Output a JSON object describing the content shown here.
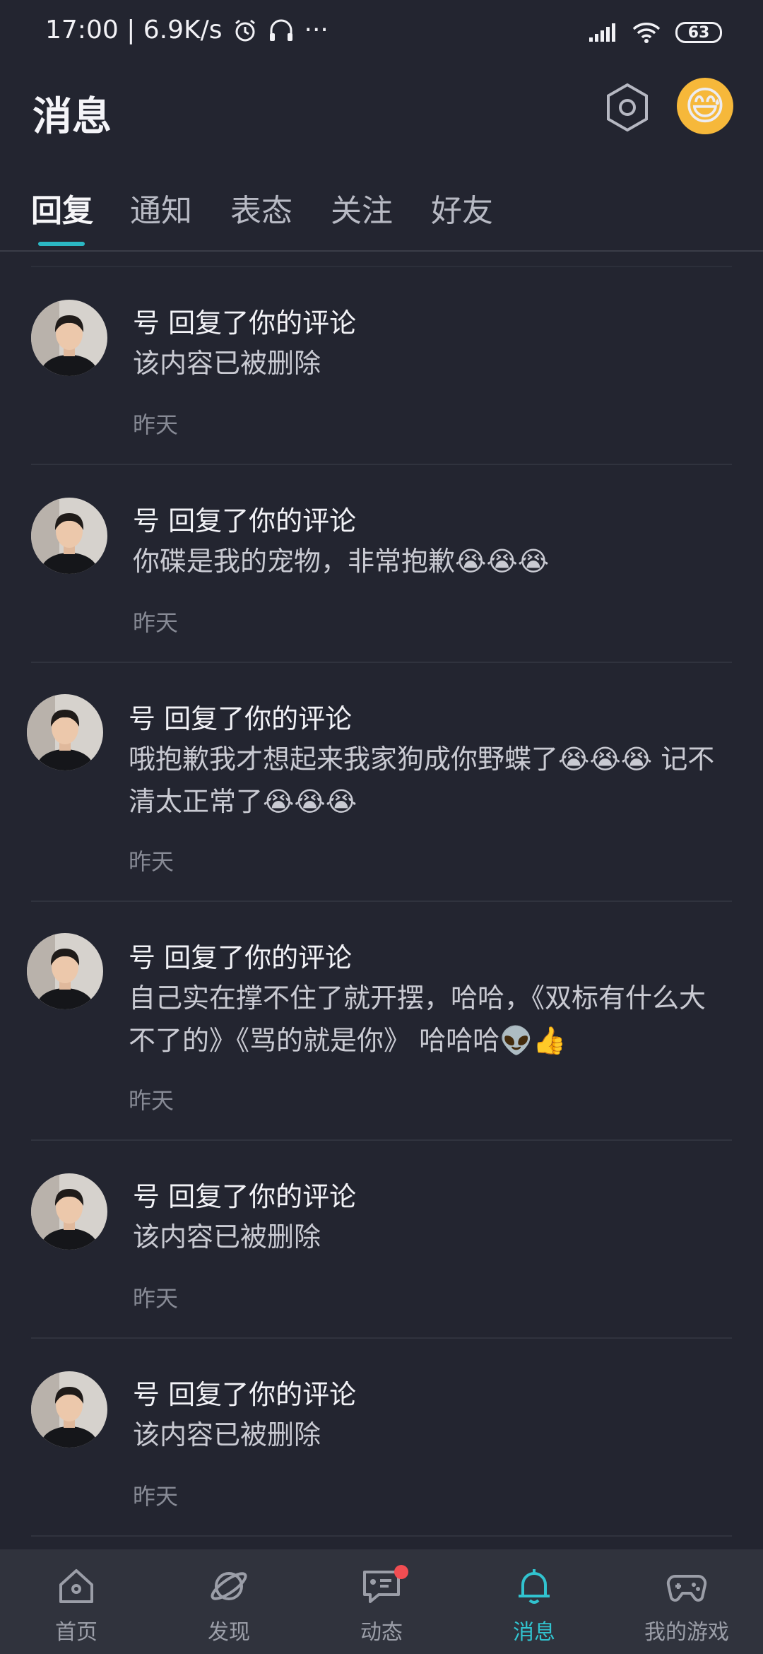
{
  "status": {
    "time_speed": "17:00 | 6.9K/s",
    "more": "···",
    "battery": "63"
  },
  "header": {
    "title": "消息"
  },
  "tabs": [
    {
      "label": "回复",
      "active": true
    },
    {
      "label": "通知",
      "active": false
    },
    {
      "label": "表态",
      "active": false
    },
    {
      "label": "关注",
      "active": false
    },
    {
      "label": "好友",
      "active": false
    }
  ],
  "items": [
    {
      "title": "号 回复了你的评论",
      "body": "该内容已被删除",
      "time": "昨天"
    },
    {
      "title": "号 回复了你的评论",
      "body": "你碟是我的宠物，非常抱歉😭😭😭",
      "time": "昨天"
    },
    {
      "title": "号 回复了你的评论",
      "body": "哦抱歉我才想起来我家狗成你野蝶了😭😭😭 记不清太正常了😭😭😭",
      "time": "昨天"
    },
    {
      "title": "号 回复了你的评论",
      "body": "自己实在撑不住了就开摆，哈哈，《双标有什么大不了的》《骂的就是你》 哈哈哈👽👍",
      "time": "昨天"
    },
    {
      "title": "号 回复了你的评论",
      "body": "该内容已被删除",
      "time": "昨天"
    },
    {
      "title": "号 回复了你的评论",
      "body": "该内容已被删除",
      "time": "昨天"
    }
  ],
  "nav": [
    {
      "label": "首页",
      "icon": "home-icon",
      "active": false
    },
    {
      "label": "发现",
      "icon": "planet-icon",
      "active": false
    },
    {
      "label": "动态",
      "icon": "feed-icon",
      "active": false,
      "badge": true
    },
    {
      "label": "消息",
      "icon": "bell-icon",
      "active": true
    },
    {
      "label": "我的游戏",
      "icon": "gamepad-icon",
      "active": false
    }
  ],
  "colors": {
    "accent": "#2bb8c4",
    "background": "#232530",
    "badge": "#f14d52"
  }
}
